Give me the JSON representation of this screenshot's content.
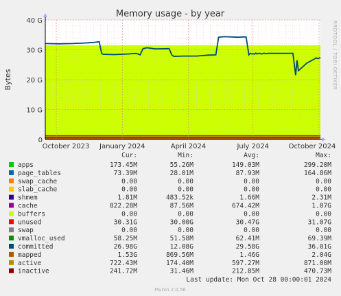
{
  "chart_data": {
    "type": "area",
    "title": "Memory usage - by year",
    "ylabel": "Bytes",
    "side_label": "RRDTOOL / TOBI OETIKER",
    "y_ticks": [
      "0",
      "10 G",
      "20 G",
      "30 G",
      "40 G"
    ],
    "y_tick_values": [
      0,
      10,
      20,
      30,
      40
    ],
    "ylim": [
      0,
      40
    ],
    "x_ticks": [
      "October 2023",
      "January 2024",
      "April 2024",
      "July 2024",
      "October 2024"
    ],
    "x_tick_positions": [
      0.04,
      0.28,
      0.52,
      0.755,
      0.995
    ],
    "xlim": [
      0,
      1
    ],
    "y_unit": "GB",
    "layers": {
      "active_level": 1.3,
      "inactive_level": 0.45,
      "cache_level": 0.7,
      "unused_top": 31.5
    },
    "committed": {
      "x": [
        0,
        0.05,
        0.1,
        0.15,
        0.18,
        0.196,
        0.205,
        0.21,
        0.25,
        0.3,
        0.33,
        0.345,
        0.355,
        0.37,
        0.4,
        0.45,
        0.46,
        0.468,
        0.5,
        0.55,
        0.59,
        0.62,
        0.63,
        0.65,
        0.7,
        0.72,
        0.73,
        0.74,
        0.745,
        0.75,
        0.755,
        0.76,
        0.765,
        0.77,
        0.775,
        0.78,
        0.785,
        0.79,
        0.795,
        0.8,
        0.81,
        0.85,
        0.9,
        0.91,
        0.915,
        0.92,
        0.95,
        0.98,
        0.985,
        0.99,
        1.0
      ],
      "y": [
        32.1,
        32.0,
        32.1,
        32.3,
        32.5,
        32.7,
        28.8,
        28.5,
        28.4,
        28.6,
        28.8,
        28.3,
        30.4,
        30.7,
        30.3,
        30.4,
        28.2,
        27.8,
        27.9,
        27.9,
        28.2,
        28.3,
        34.2,
        34.4,
        34.2,
        34.3,
        34.3,
        28.3,
        28.8,
        28.6,
        28.7,
        28.5,
        28.9,
        28.6,
        28.8,
        28.8,
        28.6,
        28.7,
        28.9,
        28.7,
        28.8,
        28.8,
        28.8,
        21.5,
        26.5,
        23.0,
        25.5,
        27.0,
        27.3,
        27.0,
        27.4,
        26.0,
        27.8,
        28.0,
        27.5,
        24.0,
        27.5,
        26.8,
        27.0,
        28.0,
        26.5,
        26.98
      ]
    },
    "legend_header": [
      "Cur:",
      "Min:",
      "Avg:",
      "Max:"
    ],
    "series": [
      {
        "name": "apps",
        "color": "#00cc00",
        "cur": "173.45M",
        "min": "55.26M",
        "avg": "149.03M",
        "max": "299.20M"
      },
      {
        "name": "page_tables",
        "color": "#0066b3",
        "cur": "73.39M",
        "min": "28.01M",
        "avg": "87.93M",
        "max": "164.86M"
      },
      {
        "name": "swap_cache",
        "color": "#ff8000",
        "cur": "0.00",
        "min": "0.00",
        "avg": "0.00",
        "max": "0.00"
      },
      {
        "name": "slab_cache",
        "color": "#ffcc00",
        "cur": "0.00",
        "min": "0.00",
        "avg": "0.00",
        "max": "0.00"
      },
      {
        "name": "shmem",
        "color": "#330099",
        "cur": "1.81M",
        "min": "483.52k",
        "avg": "1.66M",
        "max": "2.31M"
      },
      {
        "name": "cache",
        "color": "#990099",
        "cur": "822.28M",
        "min": "87.56M",
        "avg": "674.42M",
        "max": "1.07G"
      },
      {
        "name": "buffers",
        "color": "#ccff00",
        "cur": "0.00",
        "min": "0.00",
        "avg": "0.00",
        "max": "0.00"
      },
      {
        "name": "unused",
        "color": "#ff0000",
        "cur": "30.31G",
        "min": "30.00G",
        "avg": "30.47G",
        "max": "31.07G"
      },
      {
        "name": "swap",
        "color": "#808080",
        "cur": "0.00",
        "min": "0.00",
        "avg": "0.00",
        "max": "0.00"
      },
      {
        "name": "vmalloc_used",
        "color": "#008f00",
        "cur": "58.25M",
        "min": "51.58M",
        "avg": "62.41M",
        "max": "69.39M"
      },
      {
        "name": "committed",
        "color": "#00487d",
        "cur": "26.98G",
        "min": "12.08G",
        "avg": "29.58G",
        "max": "36.01G"
      },
      {
        "name": "mapped",
        "color": "#b35a00",
        "cur": "1.53G",
        "min": "869.56M",
        "avg": "1.46G",
        "max": "2.04G"
      },
      {
        "name": "active",
        "color": "#b38f00",
        "cur": "722.43M",
        "min": "174.40M",
        "avg": "597.27M",
        "max": "871.00M"
      },
      {
        "name": "inactive",
        "color": "#6b006b",
        "cur": "241.72M",
        "min": "31.46M",
        "avg": "212.85M",
        "max": "470.73M"
      }
    ],
    "legend_swatch_colors": [
      "#00cc00",
      "#0066b3",
      "#ff8000",
      "#ffcc00",
      "#330099",
      "#990099",
      "#ccff00",
      "#ff0000",
      "#808080",
      "#008f00",
      "#00487d",
      "#b35a00",
      "#b38f00",
      "#8f0000"
    ],
    "last_update": "Last update: Mon Oct 28 00:00:01 2024",
    "footer": "Munin 2.0.56"
  }
}
